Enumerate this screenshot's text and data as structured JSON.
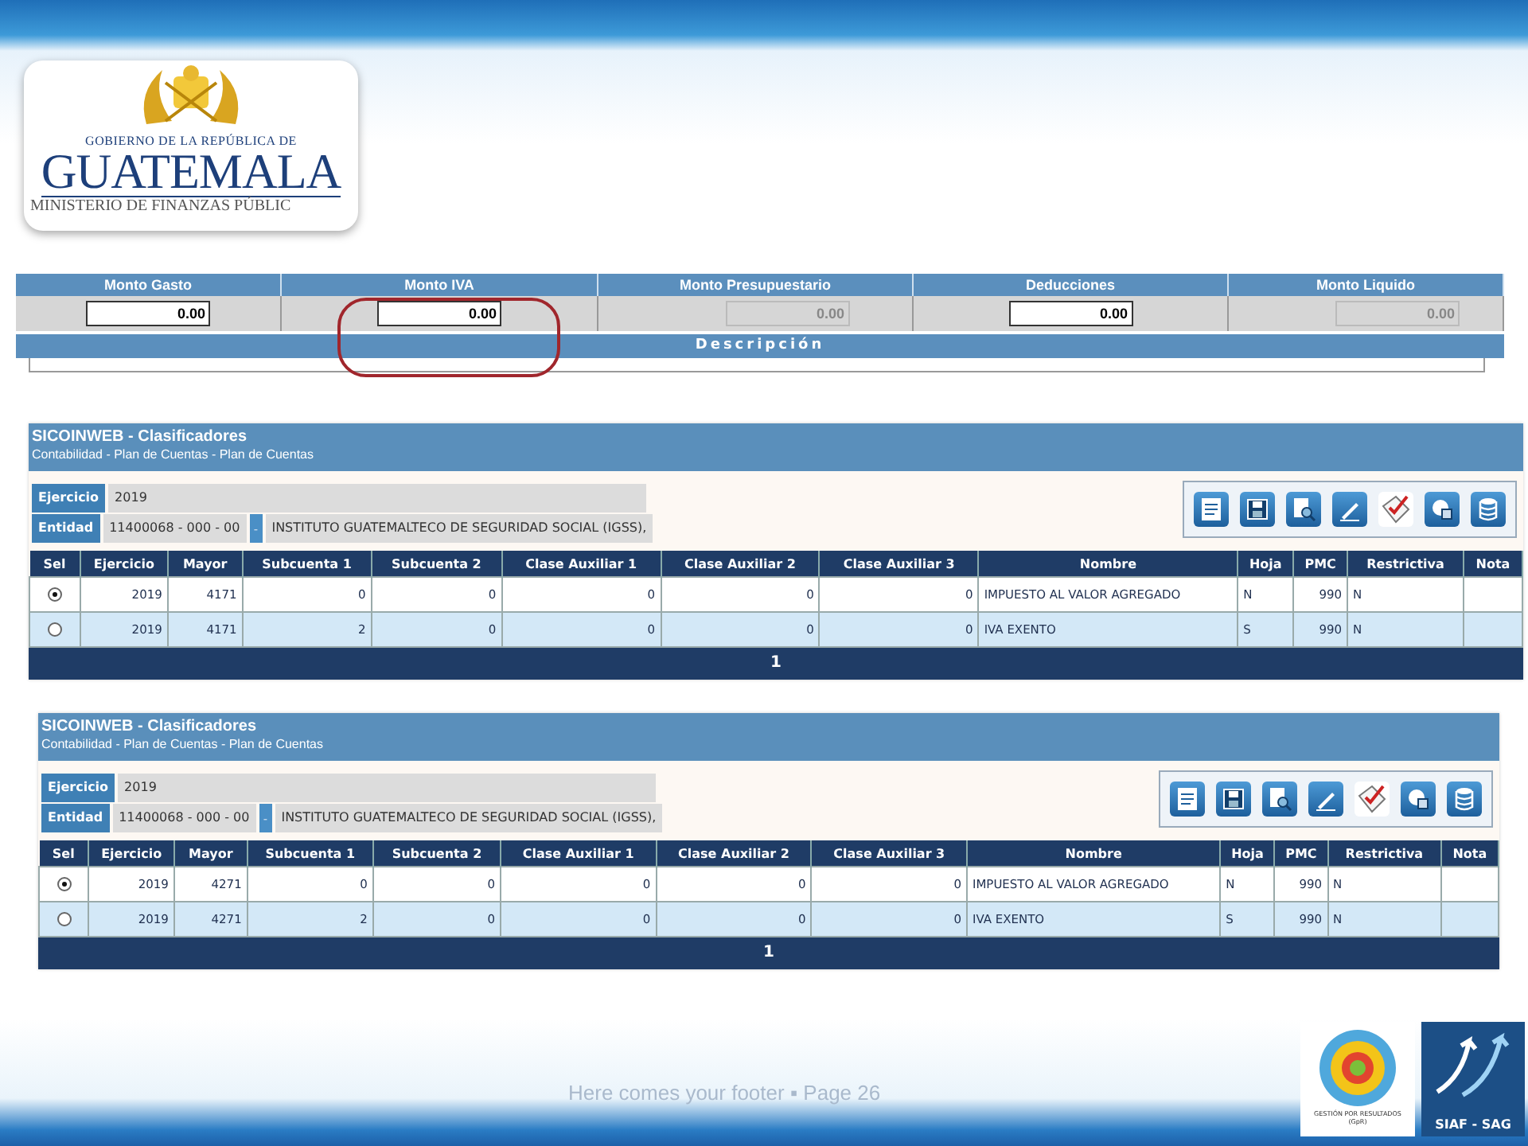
{
  "logo": {
    "line1": "GOBIERNO DE LA REPÚBLICA DE",
    "name": "GUATEMALA",
    "ministry": "MINISTERIO DE FINANZAS PÚBLIC"
  },
  "amounts": {
    "fields": [
      {
        "label": "Monto Gasto",
        "value": "0.00",
        "disabled": false,
        "highlighted": false
      },
      {
        "label": "Monto IVA",
        "value": "0.00",
        "disabled": false,
        "highlighted": true
      },
      {
        "label": "Monto Presupuestario",
        "value": "0.00",
        "disabled": true,
        "highlighted": false
      },
      {
        "label": "Deducciones",
        "value": "0.00",
        "disabled": false,
        "highlighted": false
      },
      {
        "label": "Monto Liquido",
        "value": "0.00",
        "disabled": true,
        "highlighted": false
      }
    ],
    "description_label": "Descripción"
  },
  "panels": [
    {
      "title": "SICOINWEB - Clasificadores",
      "subtitle": "Contabilidad - Plan de Cuentas - Plan de Cuentas",
      "ejercicio_label": "Ejercicio",
      "ejercicio": "2019",
      "entidad_label": "Entidad",
      "entidad_code": "11400068 - 000 - 00",
      "entidad_button": "-",
      "entidad_name": "INSTITUTO GUATEMALTECO DE SEGURIDAD SOCIAL (IGSS),",
      "columns": [
        {
          "label": "Sel",
          "kind": "radio"
        },
        {
          "label": "Ejercicio",
          "kind": "number"
        },
        {
          "label": "Mayor",
          "kind": "number"
        },
        {
          "label": "Subcuenta 1",
          "kind": "number"
        },
        {
          "label": "Subcuenta 2",
          "kind": "number"
        },
        {
          "label": "Clase Auxiliar 1",
          "kind": "number"
        },
        {
          "label": "Clase Auxiliar 2",
          "kind": "number"
        },
        {
          "label": "Clase Auxiliar 3",
          "kind": "number"
        },
        {
          "label": "Nombre",
          "kind": "text"
        },
        {
          "label": "Hoja",
          "kind": "text"
        },
        {
          "label": "PMC",
          "kind": "number"
        },
        {
          "label": "Restrictiva",
          "kind": "text"
        },
        {
          "label": "Nota",
          "kind": "text"
        }
      ],
      "rows": [
        {
          "selected": true,
          "cells": [
            "",
            "2019",
            "4171",
            "0",
            "0",
            "0",
            "0",
            "0",
            "IMPUESTO AL VALOR AGREGADO",
            "N",
            "990",
            "N"
          ]
        },
        {
          "selected": false,
          "cells": [
            "",
            "2019",
            "4171",
            "2",
            "0",
            "0",
            "0",
            "0",
            "IVA EXENTO",
            "S",
            "990",
            "N"
          ]
        }
      ],
      "pager": "1"
    },
    {
      "title": "SICOINWEB - Clasificadores",
      "subtitle": "Contabilidad - Plan de Cuentas - Plan de Cuentas",
      "ejercicio_label": "Ejercicio",
      "ejercicio": "2019",
      "entidad_label": "Entidad",
      "entidad_code": "11400068 - 000 - 00",
      "entidad_button": "-",
      "entidad_name": "INSTITUTO GUATEMALTECO DE SEGURIDAD SOCIAL (IGSS),",
      "columns": [
        {
          "label": "Sel",
          "kind": "radio"
        },
        {
          "label": "Ejercicio",
          "kind": "number"
        },
        {
          "label": "Mayor",
          "kind": "number"
        },
        {
          "label": "Subcuenta 1",
          "kind": "number"
        },
        {
          "label": "Subcuenta 2",
          "kind": "number"
        },
        {
          "label": "Clase Auxiliar 1",
          "kind": "number"
        },
        {
          "label": "Clase Auxiliar 2",
          "kind": "number"
        },
        {
          "label": "Clase Auxiliar 3",
          "kind": "number"
        },
        {
          "label": "Nombre",
          "kind": "text"
        },
        {
          "label": "Hoja",
          "kind": "text"
        },
        {
          "label": "PMC",
          "kind": "number"
        },
        {
          "label": "Restrictiva",
          "kind": "text"
        },
        {
          "label": "Nota",
          "kind": "text"
        }
      ],
      "rows": [
        {
          "selected": true,
          "cells": [
            "",
            "2019",
            "4271",
            "0",
            "0",
            "0",
            "0",
            "0",
            "IMPUESTO AL VALOR AGREGADO",
            "N",
            "990",
            "N"
          ]
        },
        {
          "selected": false,
          "cells": [
            "",
            "2019",
            "4271",
            "2",
            "0",
            "0",
            "0",
            "0",
            "IVA EXENTO",
            "S",
            "990",
            "N"
          ]
        }
      ],
      "pager": "1"
    }
  ],
  "footer": "Here comes your footer ▪ Page 26",
  "badges": {
    "gpr": "GESTIÓN POR RESULTADOS",
    "gpr_abbr": "(GpR)",
    "siaf": "SIAF - SAG"
  }
}
